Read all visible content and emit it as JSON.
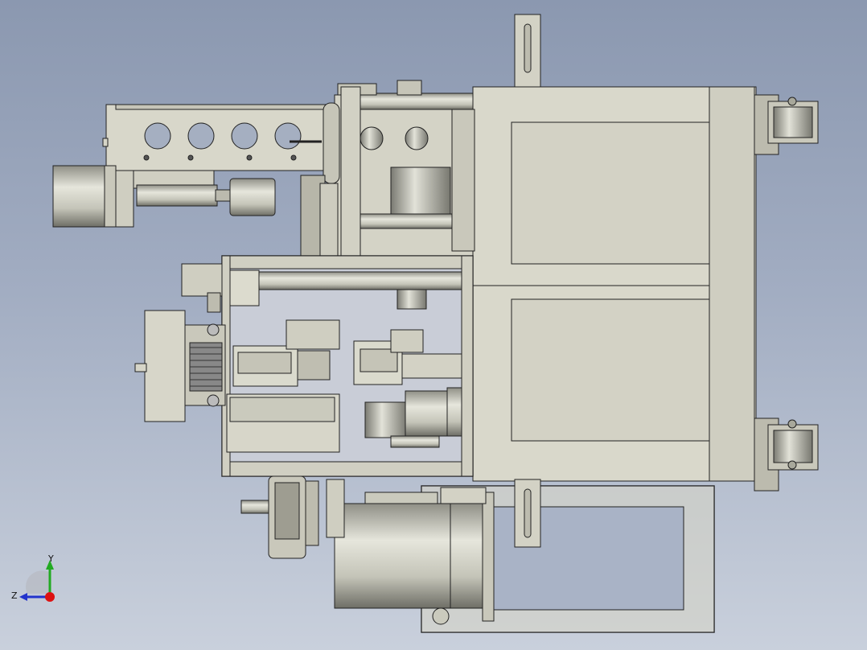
{
  "viewport": {
    "background_top": "#8b98b0",
    "background_bottom": "#c9d0dc",
    "part_fill": "#d6d5c8",
    "part_shadow": "#a8a89b",
    "part_edge": "#222222"
  },
  "triad": {
    "x_label": "",
    "y_label": "Y",
    "z_label": "Z",
    "y_color": "#22aa22",
    "z_color": "#2233cc",
    "origin_color": "#dd1111"
  }
}
